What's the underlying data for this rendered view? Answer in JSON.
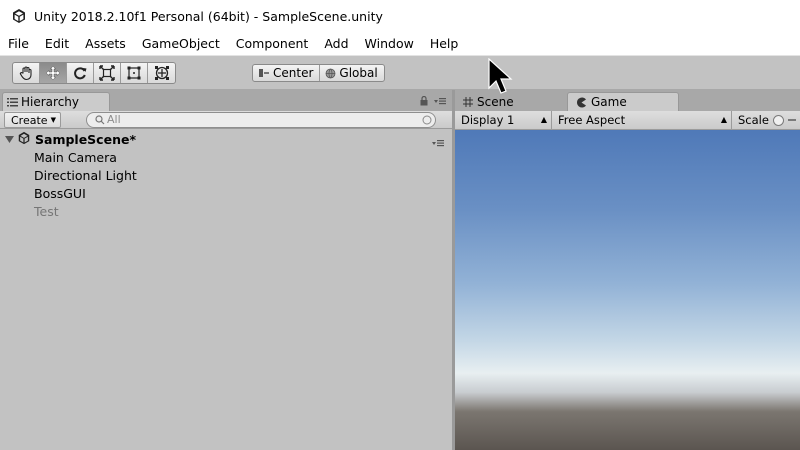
{
  "window": {
    "title": "Unity 2018.2.10f1 Personal (64bit) - SampleScene.unity"
  },
  "menu": [
    "File",
    "Edit",
    "Assets",
    "GameObject",
    "Component",
    "Add",
    "Window",
    "Help"
  ],
  "toolbar": {
    "tools": [
      "hand-tool",
      "move-tool",
      "rotate-tool",
      "scale-tool",
      "rect-tool",
      "transform-tool"
    ],
    "active_tool": "move-tool",
    "pivot": "Center",
    "space": "Global"
  },
  "hierarchy": {
    "tab_label": "Hierarchy",
    "create_label": "Create",
    "search_placeholder": "All",
    "scene_name": "SampleScene*",
    "items": [
      {
        "label": "Main Camera",
        "active": true
      },
      {
        "label": "Directional Light",
        "active": true
      },
      {
        "label": "BossGUI",
        "active": true
      },
      {
        "label": "Test",
        "active": false
      }
    ]
  },
  "game_panel": {
    "tabs": [
      "Scene",
      "Game"
    ],
    "active_tab": "Game",
    "display": "Display 1",
    "aspect": "Free Aspect",
    "scale_label": "Scale"
  },
  "colors": {
    "sky_top": "#4f79b8",
    "horizon": "#e8eff1",
    "ground": "#5b5550",
    "panel_bg": "#c2c2c2"
  }
}
